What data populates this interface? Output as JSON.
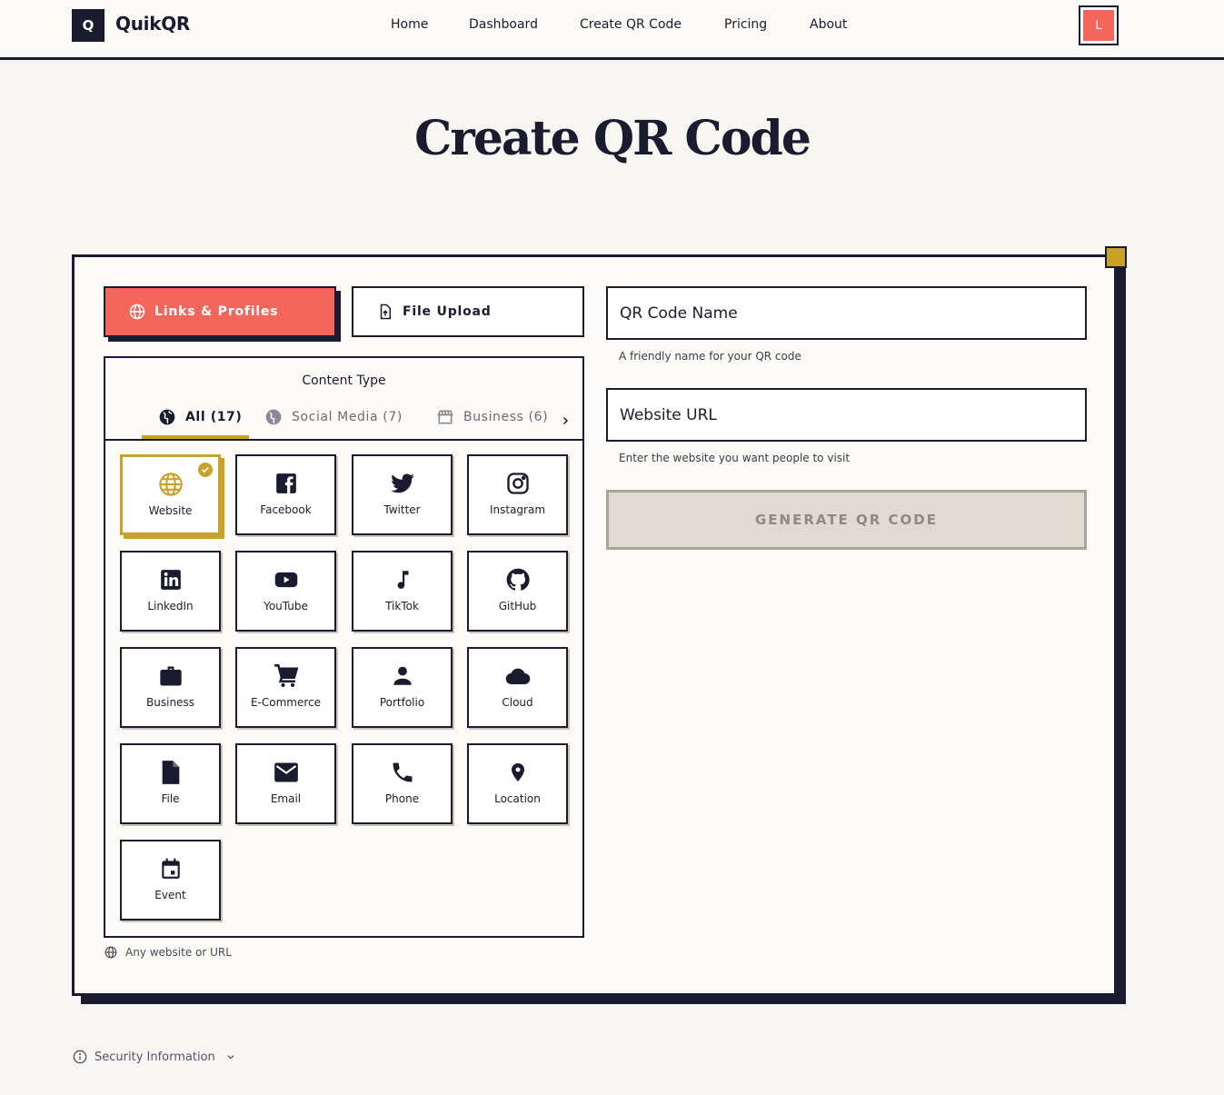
{
  "header": {
    "logo_letter": "Q",
    "brand": "QuikQR",
    "nav": [
      "Home",
      "Dashboard",
      "Create QR Code",
      "Pricing",
      "About"
    ],
    "avatar_initial": "L"
  },
  "page_title": "Create QR Code",
  "tabs": {
    "links": "Links & Profiles",
    "file": "File Upload"
  },
  "content_type": {
    "title": "Content Type",
    "categories": [
      "All (17)",
      "Social Media (7)",
      "Business (6)"
    ],
    "tiles": [
      {
        "label": "Website",
        "icon": "globe-icon"
      },
      {
        "label": "Facebook",
        "icon": "facebook-icon"
      },
      {
        "label": "Twitter",
        "icon": "twitter-icon"
      },
      {
        "label": "Instagram",
        "icon": "instagram-icon"
      },
      {
        "label": "LinkedIn",
        "icon": "linkedin-icon"
      },
      {
        "label": "YouTube",
        "icon": "youtube-icon"
      },
      {
        "label": "TikTok",
        "icon": "music-note-icon"
      },
      {
        "label": "GitHub",
        "icon": "github-icon"
      },
      {
        "label": "Business",
        "icon": "briefcase-icon"
      },
      {
        "label": "E-Commerce",
        "icon": "cart-icon"
      },
      {
        "label": "Portfolio",
        "icon": "person-icon"
      },
      {
        "label": "Cloud",
        "icon": "cloud-icon"
      },
      {
        "label": "File",
        "icon": "file-icon"
      },
      {
        "label": "Email",
        "icon": "envelope-icon"
      },
      {
        "label": "Phone",
        "icon": "phone-icon"
      },
      {
        "label": "Location",
        "icon": "pin-icon"
      },
      {
        "label": "Event",
        "icon": "calendar-icon"
      }
    ],
    "hint": "Any website or URL"
  },
  "form": {
    "name_label": "QR Code Name",
    "name_help": "A friendly name for your QR code",
    "url_label": "Website URL",
    "url_help": "Enter the website you want people to visit",
    "generate": "GENERATE QR CODE"
  },
  "security": "Security Information",
  "colors": {
    "accent": "#f4665a",
    "gold": "#c9a227",
    "ink": "#1b1b2f"
  }
}
